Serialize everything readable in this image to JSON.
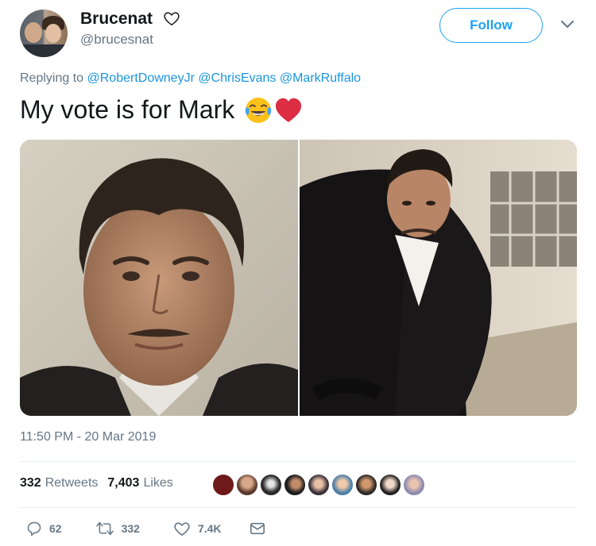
{
  "user": {
    "display_name": "Brucenat",
    "handle": "@brucesnat"
  },
  "follow_button": {
    "label": "Follow"
  },
  "reply": {
    "prefix": "Replying to",
    "mentions": [
      "@RobertDowneyJr",
      "@ChrisEvans",
      "@MarkRuffalo"
    ]
  },
  "tweet": {
    "text": "My vote is for Mark",
    "emojis": [
      "face-with-tears-of-joy",
      "red-heart"
    ]
  },
  "timestamp": "11:50 PM - 20 Mar 2019",
  "stats": {
    "retweets_count": "332",
    "retweets_label": "Retweets",
    "likes_count": "7,403",
    "likes_label": "Likes"
  },
  "actions": {
    "replies": "62",
    "retweets": "332",
    "likes": "7.4K"
  },
  "colors": {
    "accent": "#1da1f2",
    "link": "#1b95e0",
    "muted": "#657786",
    "text": "#14171a",
    "heart": "#e0245e"
  }
}
